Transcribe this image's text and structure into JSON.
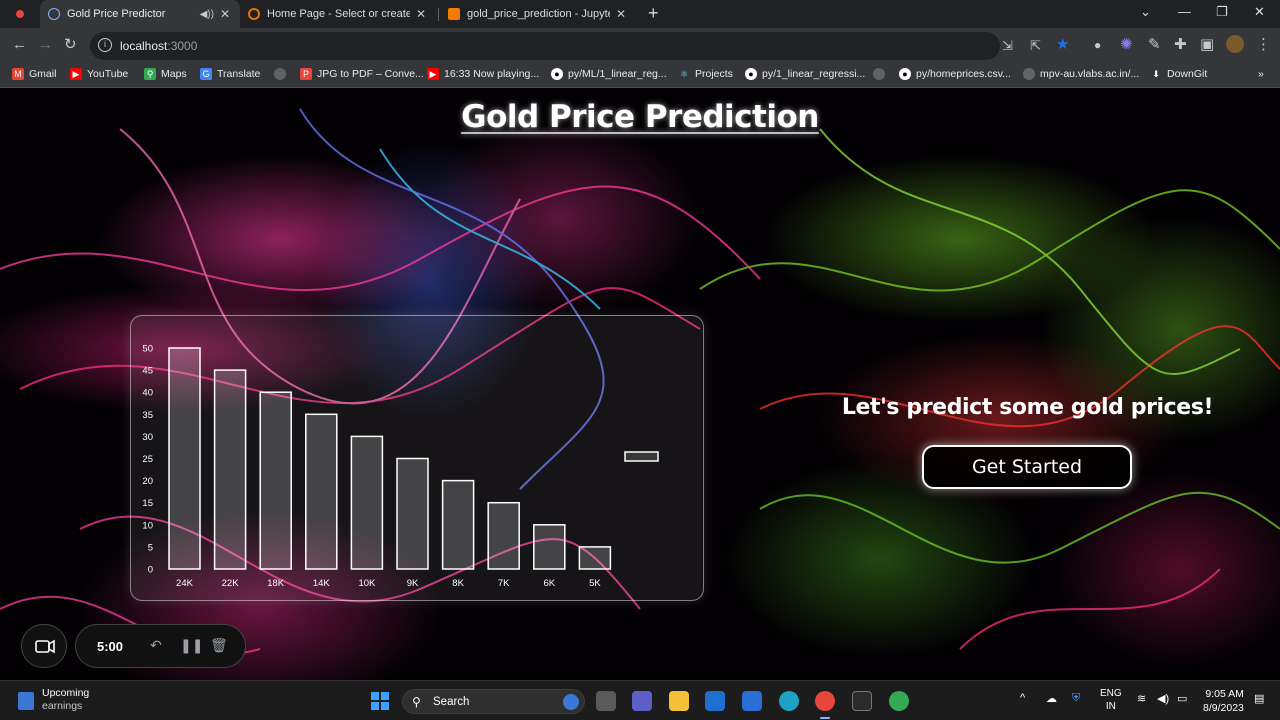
{
  "browser": {
    "tabs": [
      {
        "title": "Gold Price Predictor",
        "active": true
      },
      {
        "title": "Home Page - Select or create a n",
        "active": false
      },
      {
        "title": "gold_price_prediction - Jupyter N",
        "active": false
      }
    ],
    "url_host": "localhost",
    "url_port": ":3000",
    "bookmarks": [
      {
        "label": "Gmail",
        "icon": "gmail-icon"
      },
      {
        "label": "YouTube",
        "icon": "youtube-icon"
      },
      {
        "label": "Maps",
        "icon": "maps-icon"
      },
      {
        "label": "Translate",
        "icon": "translate-icon"
      },
      {
        "label": "JPG to PDF – Conve...",
        "icon": "pdf-icon"
      },
      {
        "label": "16:33 Now playing...",
        "icon": "youtube-icon"
      },
      {
        "label": "py/ML/1_linear_reg...",
        "icon": "github-icon"
      },
      {
        "label": "Projects",
        "icon": "react-icon"
      },
      {
        "label": "py/1_linear_regressi...",
        "icon": "github-icon"
      },
      {
        "label": "py/homeprices.csv...",
        "icon": "github-icon"
      },
      {
        "label": "mpv-au.vlabs.ac.in/...",
        "icon": "globe-icon"
      },
      {
        "label": "DownGit",
        "icon": "download-icon"
      }
    ]
  },
  "page": {
    "title": "Gold Price Prediction",
    "tagline": "Let's predict some gold prices!",
    "cta_label": "Get Started"
  },
  "chart_data": {
    "type": "bar",
    "categories": [
      "24K",
      "22K",
      "18K",
      "14K",
      "10K",
      "9K",
      "8K",
      "7K",
      "6K",
      "5K"
    ],
    "values": [
      50,
      45,
      40,
      35,
      30,
      25,
      20,
      15,
      10,
      5
    ],
    "title": "",
    "xlabel": "",
    "ylabel": "",
    "ylim": [
      0,
      50
    ],
    "yticks": [
      0,
      5,
      10,
      15,
      20,
      25,
      30,
      35,
      40,
      45,
      50
    ],
    "grid": false,
    "legend": "top-right",
    "colors": {
      "bar_fill": "#ffffff33",
      "bar_stroke": "#ffffff"
    }
  },
  "recorder": {
    "time": "5:00"
  },
  "taskbar": {
    "weather_line1": "Upcoming",
    "weather_line2": "earnings",
    "search_label": "Search",
    "lang_line1": "ENG",
    "lang_line2": "IN",
    "time": "9:05 AM",
    "date": "8/9/2023"
  },
  "colors": {
    "chrome_dark": "#202124",
    "chrome_mid": "#35363a",
    "accent_blue": "#8ab4f8",
    "star_blue": "#1a73e8"
  }
}
